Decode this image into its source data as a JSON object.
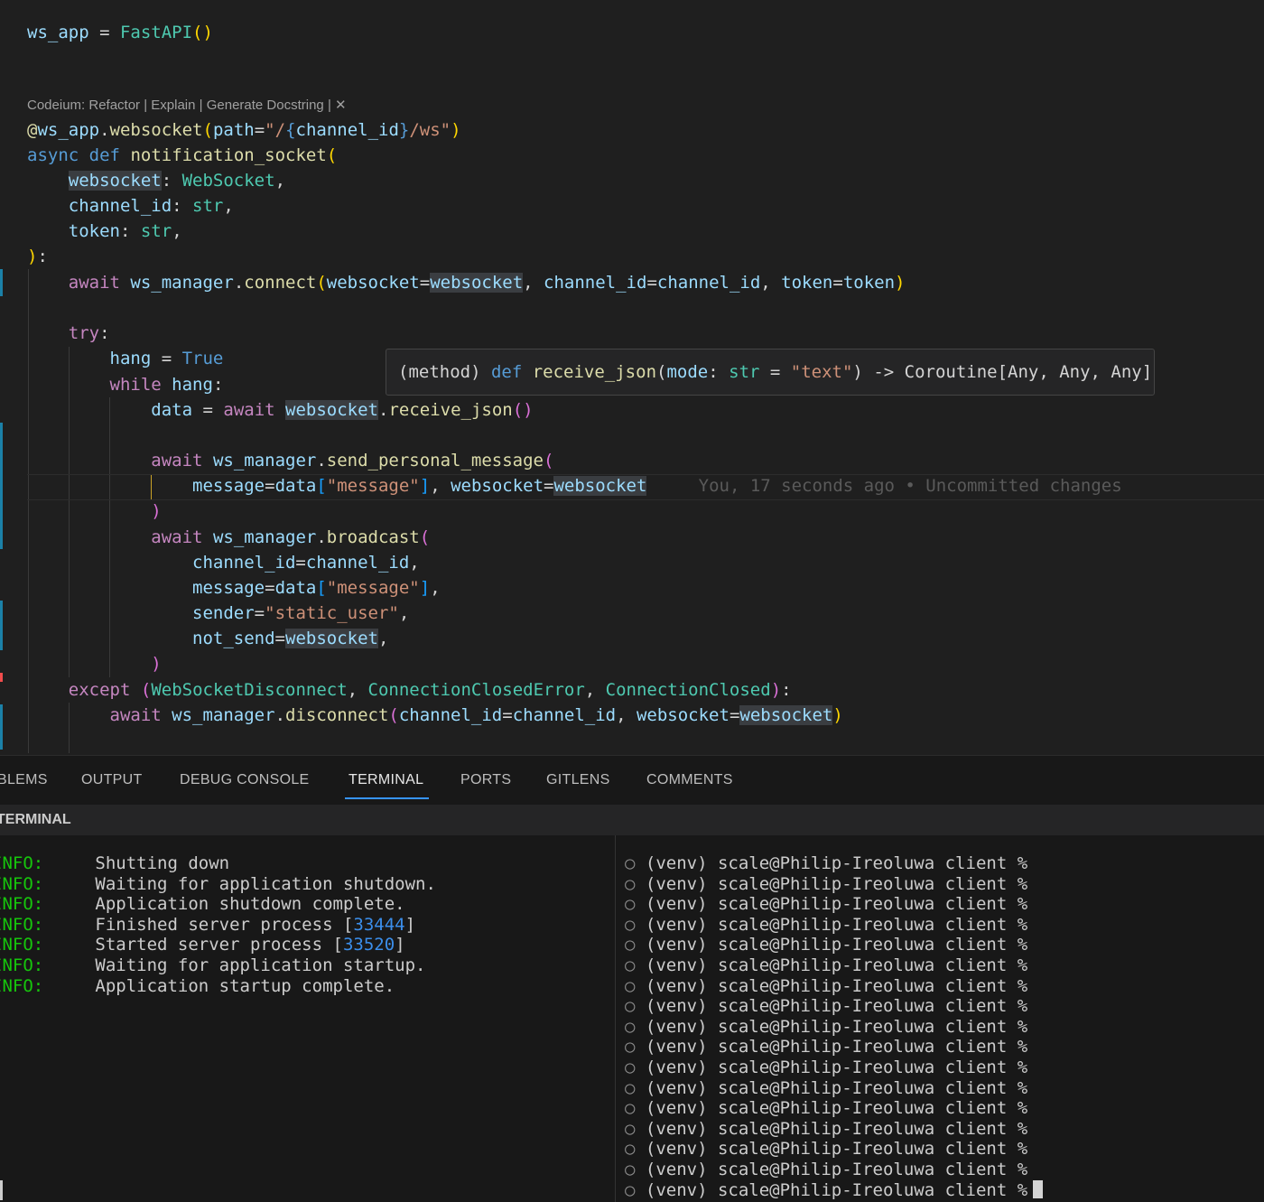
{
  "editor": {
    "codelens": "Codeium: Refactor | Explain | Generate Docstring | ✕",
    "line1": {
      "var": "ws_app",
      "op": " = ",
      "cls": "FastAPI",
      "br": "()"
    },
    "decorator": {
      "at": "@",
      "var": "ws_app",
      "dot": ".",
      "func": "websocket",
      "br1": "(",
      "param": "path",
      "eq": "=",
      "str1": "\"/",
      "braceOpen": "{",
      "str2": "channel_id",
      "braceClose": "}",
      "str3": "/ws\"",
      "br2": ")"
    },
    "def_line": {
      "async": "async",
      "def": "def",
      "name": "notification_socket",
      "br": "("
    },
    "params": [
      {
        "name": "websocket",
        "colon": ": ",
        "type": "WebSocket",
        "comma": ","
      },
      {
        "name": "channel_id",
        "colon": ": ",
        "type": "str",
        "comma": ","
      },
      {
        "name": "token",
        "colon": ": ",
        "type": "str",
        "comma": ","
      }
    ],
    "close_def": {
      "br": ")",
      "colon": ":"
    },
    "connect_line": {
      "await": "await",
      "obj": "ws_manager",
      "dot": ".",
      "func": "connect",
      "br1": "(",
      "a1": "websocket",
      "eq": "=",
      "v1": "websocket",
      "comma": ", ",
      "a2": "channel_id",
      "v2": "channel_id",
      "a3": "token",
      "v3": "token",
      "br2": ")"
    },
    "try": "try",
    "colon": ":",
    "hang_line": {
      "var": "hang",
      "op": " = ",
      "val": "True"
    },
    "while_line": {
      "kw": "while",
      "var": "hang",
      "colon": ":"
    },
    "data_line": {
      "var": "data",
      "op": " = ",
      "await": "await",
      "obj": "websocket",
      "dot": ".",
      "func": "receive_json",
      "br": "()"
    },
    "send_line": {
      "await": "await",
      "obj": "ws_manager",
      "dot": ".",
      "func": "send_personal_message",
      "br": "("
    },
    "send_args": {
      "a1": "message",
      "eq": "=",
      "v1": "data",
      "br1": "[",
      "s1": "\"message\"",
      "br2": "]",
      "comma": ", ",
      "a2": "websocket",
      "v2": "websocket"
    },
    "blame": "You, 17 seconds ago • Uncommitted changes",
    "close_paren": ")",
    "broadcast_line": {
      "await": "await",
      "obj": "ws_manager",
      "dot": ".",
      "func": "broadcast",
      "br": "("
    },
    "broadcast_args": [
      {
        "a": "channel_id",
        "eq": "=",
        "v": "channel_id",
        "comma": ","
      },
      {
        "a": "message",
        "eq": "=",
        "v": "data",
        "br1": "[",
        "s": "\"message\"",
        "br2": "]",
        "comma": ","
      },
      {
        "a": "sender",
        "eq": "=",
        "s": "\"static_user\"",
        "comma": ","
      },
      {
        "a": "not_send",
        "eq": "=",
        "v": "websocket",
        "comma": ","
      }
    ],
    "except_line": {
      "kw": "except",
      "br1": "(",
      "c1": "WebSocketDisconnect",
      "c2": "ConnectionClosedError",
      "c3": "ConnectionClosed",
      "sep": ", ",
      "br2": ")",
      "colon": ":"
    },
    "disconnect_line": {
      "await": "await",
      "obj": "ws_manager",
      "dot": ".",
      "func": "disconnect",
      "br1": "(",
      "a1": "channel_id",
      "eq": "=",
      "v1": "channel_id",
      "comma": ", ",
      "a2": "websocket",
      "v2": "websocket",
      "br2": ")"
    }
  },
  "hover": {
    "prefix": "(method) ",
    "def": "def",
    "name": "receive_json",
    "br1": "(",
    "param": "mode",
    "colon": ": ",
    "type": "str",
    "eq": " = ",
    "default": "\"text\"",
    "br2": ")",
    "ret": " -> Coroutine[Any, Any, Any]"
  },
  "panel": {
    "tabs": [
      "BLEMS",
      "OUTPUT",
      "DEBUG CONSOLE",
      "TERMINAL",
      "PORTS",
      "GITLENS",
      "COMMENTS"
    ],
    "active_tab": "TERMINAL",
    "subheader": "TERMINAL"
  },
  "terminal_left": [
    {
      "level": "INFO:",
      "msg": "Shutting down"
    },
    {
      "level": "INFO:",
      "msg": "Waiting for application shutdown."
    },
    {
      "level": "INFO:",
      "msg": "Application shutdown complete."
    },
    {
      "level": "INFO:",
      "msg": "Finished server process ",
      "br1": "[",
      "num": "33444",
      "br2": "]"
    },
    {
      "level": "INFO:",
      "msg": "Started server process ",
      "br1": "[",
      "num": "33520",
      "br2": "]"
    },
    {
      "level": "INFO:",
      "msg": "Waiting for application startup."
    },
    {
      "level": "INFO:",
      "msg": "Application startup complete."
    }
  ],
  "terminal_right": {
    "dot": "○",
    "prompt": "(venv) scale@Philip-Ireoluwa client %",
    "count": 17
  },
  "colors": {
    "accent": "#3794ff",
    "info": "#16c60c",
    "number": "#3b8eea"
  }
}
